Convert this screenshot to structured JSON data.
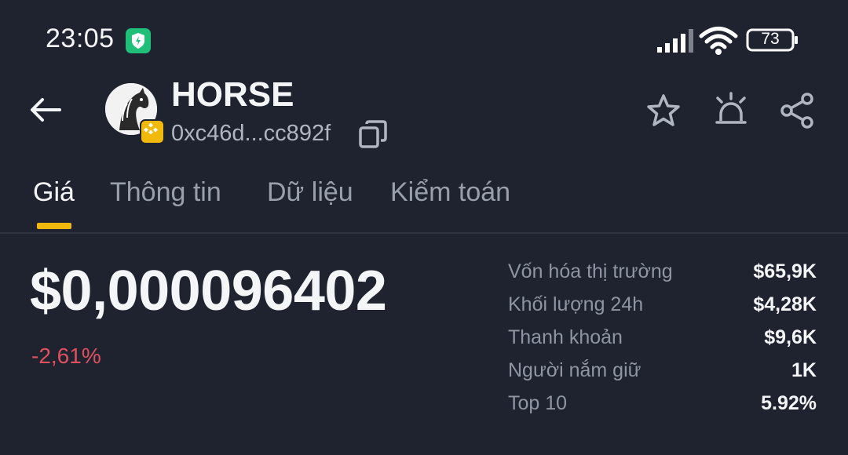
{
  "status_bar": {
    "time": "23:05",
    "battery": "73",
    "icons": [
      "shield-icon",
      "signal-icon",
      "wifi-icon",
      "battery-icon"
    ]
  },
  "header": {
    "token_name": "HORSE",
    "address": "0xc46d...cc892f",
    "icons": [
      "back-arrow-icon",
      "horse-avatar",
      "bnb-chain-icon",
      "copy-icon",
      "star-icon",
      "alert-icon",
      "share-icon"
    ]
  },
  "tabs": [
    "Giá",
    "Thông tin",
    "Dữ liệu",
    "Kiểm toán"
  ],
  "active_tab": "Giá",
  "price": {
    "value": "$0,000096402",
    "change": "-2,61%"
  },
  "stats": [
    {
      "label": "Vốn hóa thị trường",
      "value": "$65,9K"
    },
    {
      "label": "Khối lượng 24h",
      "value": "$4,28K"
    },
    {
      "label": "Thanh khoản",
      "value": "$9,6K"
    },
    {
      "label": "Người nắm giữ",
      "value": "1K"
    },
    {
      "label": "Top 10",
      "value": "5.92%"
    }
  ],
  "colors": {
    "background": "#1f2330",
    "accent": "#f0b90b",
    "negative": "#e0505f",
    "shield": "#1fbf7a"
  }
}
